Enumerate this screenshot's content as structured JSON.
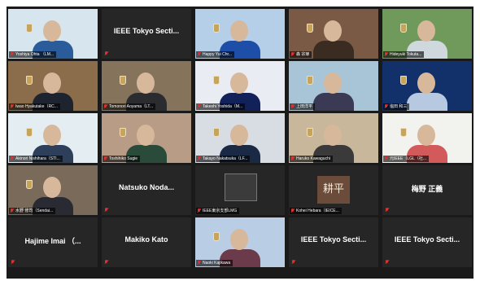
{
  "tiles": [
    {
      "label": "Yoshiya Ohta （LM...",
      "kind": "video",
      "bg": "#d7e6ee",
      "accent": "#2a5b9a"
    },
    {
      "label": "IEEE Tokyo Secti...",
      "kind": "name"
    },
    {
      "label": "Happy Yui Chr...",
      "kind": "video",
      "bg": "#b6cfe8",
      "accent": "#1e4fa8",
      "active": true
    },
    {
      "label": "森 宗琢",
      "kind": "video",
      "bg": "#7a5a45",
      "accent": "#3b2c22"
    },
    {
      "label": "Hideyuki Tokuta...",
      "kind": "video",
      "bg": "#6f9a5c",
      "accent": "#cfd8dc"
    },
    {
      "label": "Iwao Hyakutake（RC...",
      "kind": "video",
      "bg": "#8b6c4b",
      "accent": "#1d2430"
    },
    {
      "label": "Tomonori Aoyama（LT...",
      "kind": "video",
      "bg": "#86735c",
      "accent": "#2a2c30"
    },
    {
      "label": "Takeshi Yoshida（M...",
      "kind": "video",
      "bg": "#e9edf3",
      "accent": "#12215a"
    },
    {
      "label": "上田洋平",
      "kind": "video",
      "bg": "#a8c5d8",
      "accent": "#3a3a55"
    },
    {
      "label": "塩田 和三",
      "kind": "video",
      "bg": "#12306a",
      "accent": "#b7c9e0"
    },
    {
      "label": "Akinori Nishihara（STI...",
      "kind": "video",
      "bg": "#e4edf1",
      "accent": "#2d3f5a"
    },
    {
      "label": "Toshihiko Sugie",
      "kind": "video",
      "bg": "#b89c86",
      "accent": "#2a4a3a"
    },
    {
      "label": "Takayo Nakatsuka（LF...",
      "kind": "video",
      "bg": "#d8dde4",
      "accent": "#1b2a44"
    },
    {
      "label": "Haruko Kawaguchi",
      "kind": "video",
      "bg": "#c8b79a",
      "accent": "#3a3a3a"
    },
    {
      "label": "元IEEE（LGL（社...",
      "kind": "video",
      "bg": "#f2f2ee",
      "accent": "#d25a5a"
    },
    {
      "label": "水野 修司（Sendai...",
      "kind": "video",
      "bg": "#7a6a5a",
      "accent": "#2a2a33"
    },
    {
      "label": "Natsuko Noda...",
      "kind": "name"
    },
    {
      "label": "IEEE東京支部LMG",
      "kind": "photo"
    },
    {
      "label": "Kohei Hebara（IEICE...",
      "kind": "logo",
      "logo_text": "耕平"
    },
    {
      "label": "梅野 正義",
      "kind": "name"
    },
    {
      "label": "Hajime Imai （...",
      "kind": "name"
    },
    {
      "label": "Makiko Kato",
      "kind": "name"
    },
    {
      "label": "Naoki Kajikawa",
      "kind": "video",
      "bg": "#b9cde4",
      "accent": "#6b3b4b"
    },
    {
      "label": "IEEE Tokyo Secti...",
      "kind": "name"
    },
    {
      "label": "IEEE Tokyo Secti...",
      "kind": "name"
    }
  ]
}
